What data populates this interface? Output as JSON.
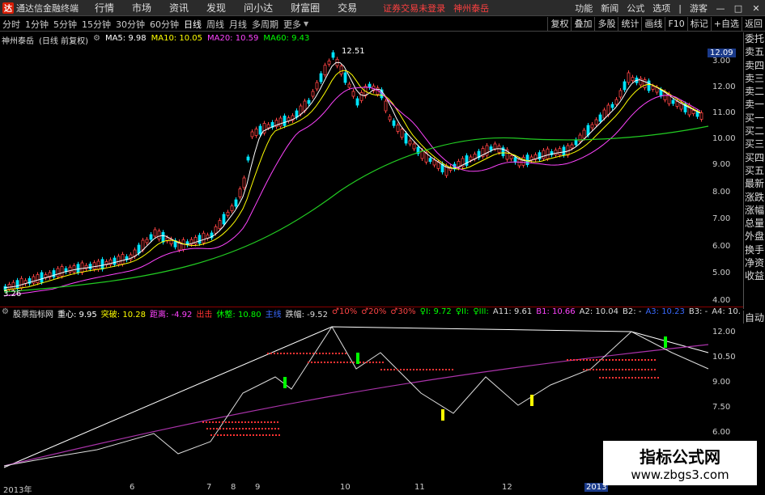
{
  "titlebar": {
    "app": "通达信金融终端",
    "menu": [
      "行情",
      "市场",
      "资讯",
      "发现",
      "问小达",
      "财富圈",
      "交易"
    ],
    "notice": "证券交易未登录",
    "stock": "神州泰岳",
    "right": [
      "功能",
      "新闻",
      "公式",
      "选项",
      "|",
      "游客"
    ]
  },
  "toolbar": {
    "periods": [
      "分时",
      "1分钟",
      "5分钟",
      "15分钟",
      "30分钟",
      "60分钟",
      "日线",
      "周线",
      "月线",
      "多周期",
      "更多"
    ],
    "active": "日线",
    "right": [
      "复权",
      "叠加",
      "多股",
      "统计",
      "画线",
      "F10",
      "标记",
      "+自选",
      "返回"
    ]
  },
  "main_legend": {
    "name": "神州泰岳",
    "mode": "(日线 前复权)",
    "ma": [
      {
        "label": "MA5: 9.98",
        "color": "#ffffff"
      },
      {
        "label": "MA10: 10.05",
        "color": "#ffff00"
      },
      {
        "label": "MA20: 10.59",
        "color": "#ff44ff"
      },
      {
        "label": "MA60: 9.43",
        "color": "#00ff00"
      }
    ],
    "high_label": "12.51",
    "low_label": "3.26",
    "price": "12.09"
  },
  "yaxis_main": [
    "12.00",
    "11.00",
    "10.00",
    "9.00",
    "8.00",
    "7.00",
    "6.00",
    "5.00",
    "4.00",
    "3.00"
  ],
  "right_panel": [
    "委托",
    "卖五",
    "卖四",
    "卖三",
    "卖二",
    "卖一",
    "买一",
    "买二",
    "买三",
    "买四",
    "买五",
    "最新",
    "涨跌",
    "涨幅",
    "总量",
    "外盘",
    "换手",
    "净资",
    "收益"
  ],
  "sub_legend": [
    {
      "t": "股票指标网",
      "c": "#ddd"
    },
    {
      "t": "重心: 9.95",
      "c": "#fff"
    },
    {
      "t": "突破: 10.28",
      "c": "#ffff00"
    },
    {
      "t": "距离: -4.92",
      "c": "#ff44ff"
    },
    {
      "t": "出击",
      "c": "#ff3333"
    },
    {
      "t": "休整: 10.80",
      "c": "#00ff00"
    },
    {
      "t": "主线",
      "c": "#3a6aff"
    },
    {
      "t": "跌幅: -9.52",
      "c": "#ddd"
    },
    {
      "t": "♂10%",
      "c": "#ff4444"
    },
    {
      "t": "♂20%",
      "c": "#ff4444"
    },
    {
      "t": "♂30%",
      "c": "#ff4444"
    },
    {
      "t": "♀I: 9.72",
      "c": "#00ff00"
    },
    {
      "t": "♀II:",
      "c": "#00ff00"
    },
    {
      "t": "♀III:",
      "c": "#00ff00"
    },
    {
      "t": "A11: 9.61",
      "c": "#ddd"
    },
    {
      "t": "B1: 10.66",
      "c": "#ff44ff"
    },
    {
      "t": "A2: 10.04",
      "c": "#ddd"
    },
    {
      "t": "B2: -",
      "c": "#ddd"
    },
    {
      "t": "A3: 10.23",
      "c": "#3a6aff"
    },
    {
      "t": "B3: -",
      "c": "#ddd"
    },
    {
      "t": "A4: 10.",
      "c": "#ddd"
    }
  ],
  "auto_label": "自动",
  "yaxis_sub": [
    "12.00",
    "10.50",
    "9.00",
    "7.50",
    "6.00"
  ],
  "xaxis": [
    "2013年",
    "6",
    "7",
    "8",
    "9",
    "10",
    "11",
    "12",
    "2013"
  ],
  "watermark": {
    "line1": "指标公式网",
    "line2": "www.zbgs3.com"
  }
}
